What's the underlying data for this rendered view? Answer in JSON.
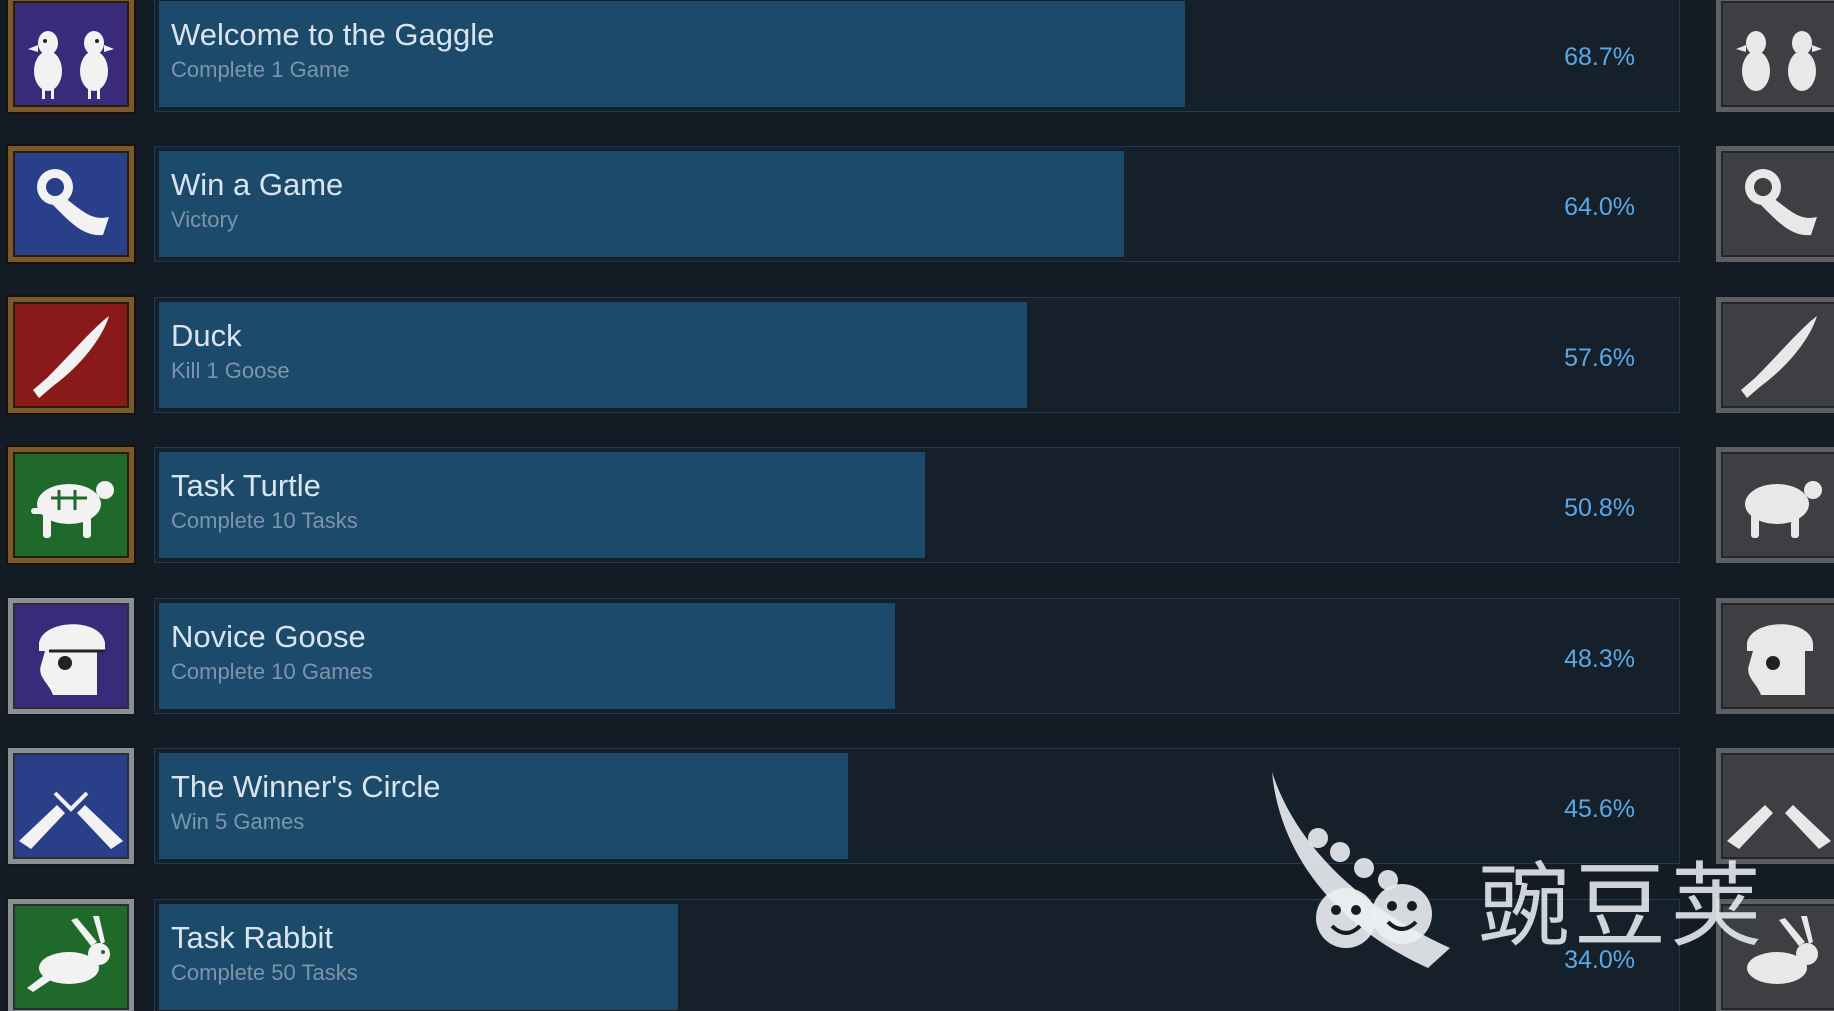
{
  "achievements": [
    {
      "name": "Welcome to the Gaggle",
      "description": "Complete 1 Game",
      "percent_label": "68.7%",
      "percent": 68.7,
      "icon": "two-geese-icon",
      "icon_bg": "#3a2a7a",
      "frame": "gold"
    },
    {
      "name": "Win a Game",
      "description": "Victory",
      "percent_label": "64.0%",
      "percent": 64.0,
      "icon": "ribbon-icon",
      "icon_bg": "#2a3f8a",
      "frame": "gold"
    },
    {
      "name": "Duck",
      "description": "Kill 1 Goose",
      "percent_label": "57.6%",
      "percent": 57.6,
      "icon": "knife-icon",
      "icon_bg": "#8a1a1a",
      "frame": "gold"
    },
    {
      "name": "Task Turtle",
      "description": "Complete 10 Tasks",
      "percent_label": "50.8%",
      "percent": 50.8,
      "icon": "turtle-icon",
      "icon_bg": "#1f6a2a",
      "frame": "gold"
    },
    {
      "name": "Novice Goose",
      "description": "Complete 10 Games",
      "percent_label": "48.3%",
      "percent": 48.3,
      "icon": "goose-helmet-icon",
      "icon_bg": "#3a2a7a",
      "frame": "silver"
    },
    {
      "name": "The Winner's Circle",
      "description": "Win 5 Games",
      "percent_label": "45.6%",
      "percent": 45.6,
      "icon": "cheers-icon",
      "icon_bg": "#2a3f8a",
      "frame": "silver"
    },
    {
      "name": "Task Rabbit",
      "description": "Complete 50 Tasks",
      "percent_label": "34.0%",
      "percent": 34.0,
      "icon": "rabbit-icon",
      "icon_bg": "#1f6a2a",
      "frame": "silver"
    }
  ],
  "watermark": {
    "text": "豌豆荚",
    "icon": "pea-pod-logo-icon"
  }
}
